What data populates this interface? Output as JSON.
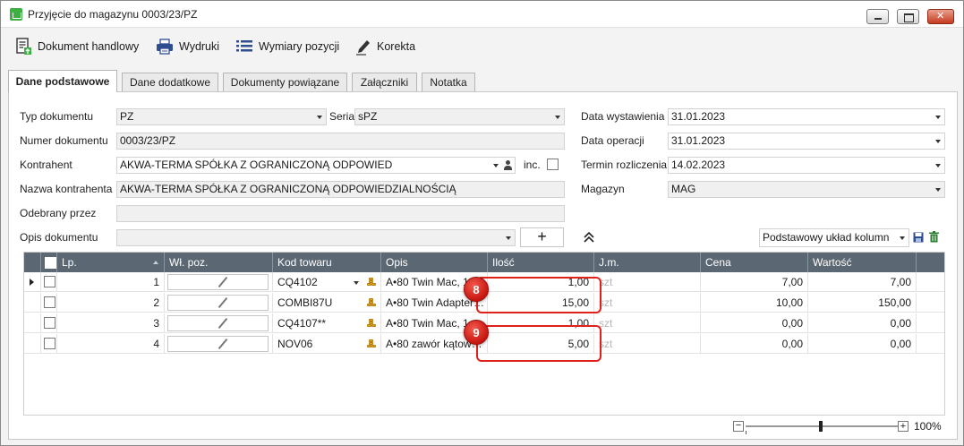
{
  "window": {
    "title": "Przyjęcie do magazynu 0003/23/PZ"
  },
  "toolbar": {
    "dokument_handlowy": "Dokument handlowy",
    "wydruki": "Wydruki",
    "wymiary_pozycji": "Wymiary pozycji",
    "korekta": "Korekta"
  },
  "tabs": [
    "Dane podstawowe",
    "Dane dodatkowe",
    "Dokumenty powiązane",
    "Załączniki",
    "Notatka"
  ],
  "form": {
    "typ_label": "Typ dokumentu",
    "typ_value": "PZ",
    "seria_label": "Seria",
    "seria_value": "sPZ",
    "numer_label": "Numer dokumentu",
    "numer_value": "0003/23/PZ",
    "kontrahent_label": "Kontrahent",
    "kontrahent_value": "AKWA-TERMA SPÓŁKA Z OGRANICZONĄ ODPOWIED",
    "inc_label": "inc.",
    "nazwa_label": "Nazwa kontrahenta",
    "nazwa_value": "AKWA-TERMA SPÓŁKA Z OGRANICZONĄ ODPOWIEDZIALNOŚCIĄ",
    "odebrany_label": "Odebrany przez",
    "odebrany_value": "",
    "opis_label": "Opis dokumentu",
    "opis_value": "",
    "plus": "+",
    "data_wyst_label": "Data wystawienia",
    "data_wyst_value": "31.01.2023",
    "data_op_label": "Data operacji",
    "data_op_value": "31.01.2023",
    "termin_label": "Termin rozliczenia",
    "termin_value": "14.02.2023",
    "magazyn_label": "Magazyn",
    "magazyn_value": "MAG",
    "uklad_value": "Podstawowy układ kolumn"
  },
  "grid": {
    "headers": [
      "Lp.",
      "Wł. poz.",
      "Kod towaru",
      "Opis",
      "Ilość",
      "J.m.",
      "Cena",
      "Wartość"
    ],
    "rows": [
      {
        "lp": "1",
        "kod": "CQ4102",
        "opis": "A•80 Twin Mac, 1…",
        "ilosc": "1,00",
        "jm": "szt",
        "cena": "7,00",
        "wartosc": "7,00"
      },
      {
        "lp": "2",
        "kod": "COMBI87U",
        "opis": "A•80 Twin Adapter…",
        "ilosc": "15,00",
        "jm": "szt",
        "cena": "10,00",
        "wartosc": "150,00"
      },
      {
        "lp": "3",
        "kod": "CQ4107**",
        "opis": "A•80 Twin Mac, 1…",
        "ilosc": "1,00",
        "jm": "szt",
        "cena": "0,00",
        "wartosc": "0,00"
      },
      {
        "lp": "4",
        "kod": "NOV06",
        "opis": "A•80 zawór kątow…",
        "ilosc": "5,00",
        "jm": "szt",
        "cena": "0,00",
        "wartosc": "0,00"
      }
    ]
  },
  "callouts": [
    "8",
    "9"
  ],
  "zoom": {
    "minus": "−",
    "plus": "+",
    "level": "100%"
  },
  "colors": {
    "header_bg": "#5b6772",
    "callout": "#e0201b"
  }
}
